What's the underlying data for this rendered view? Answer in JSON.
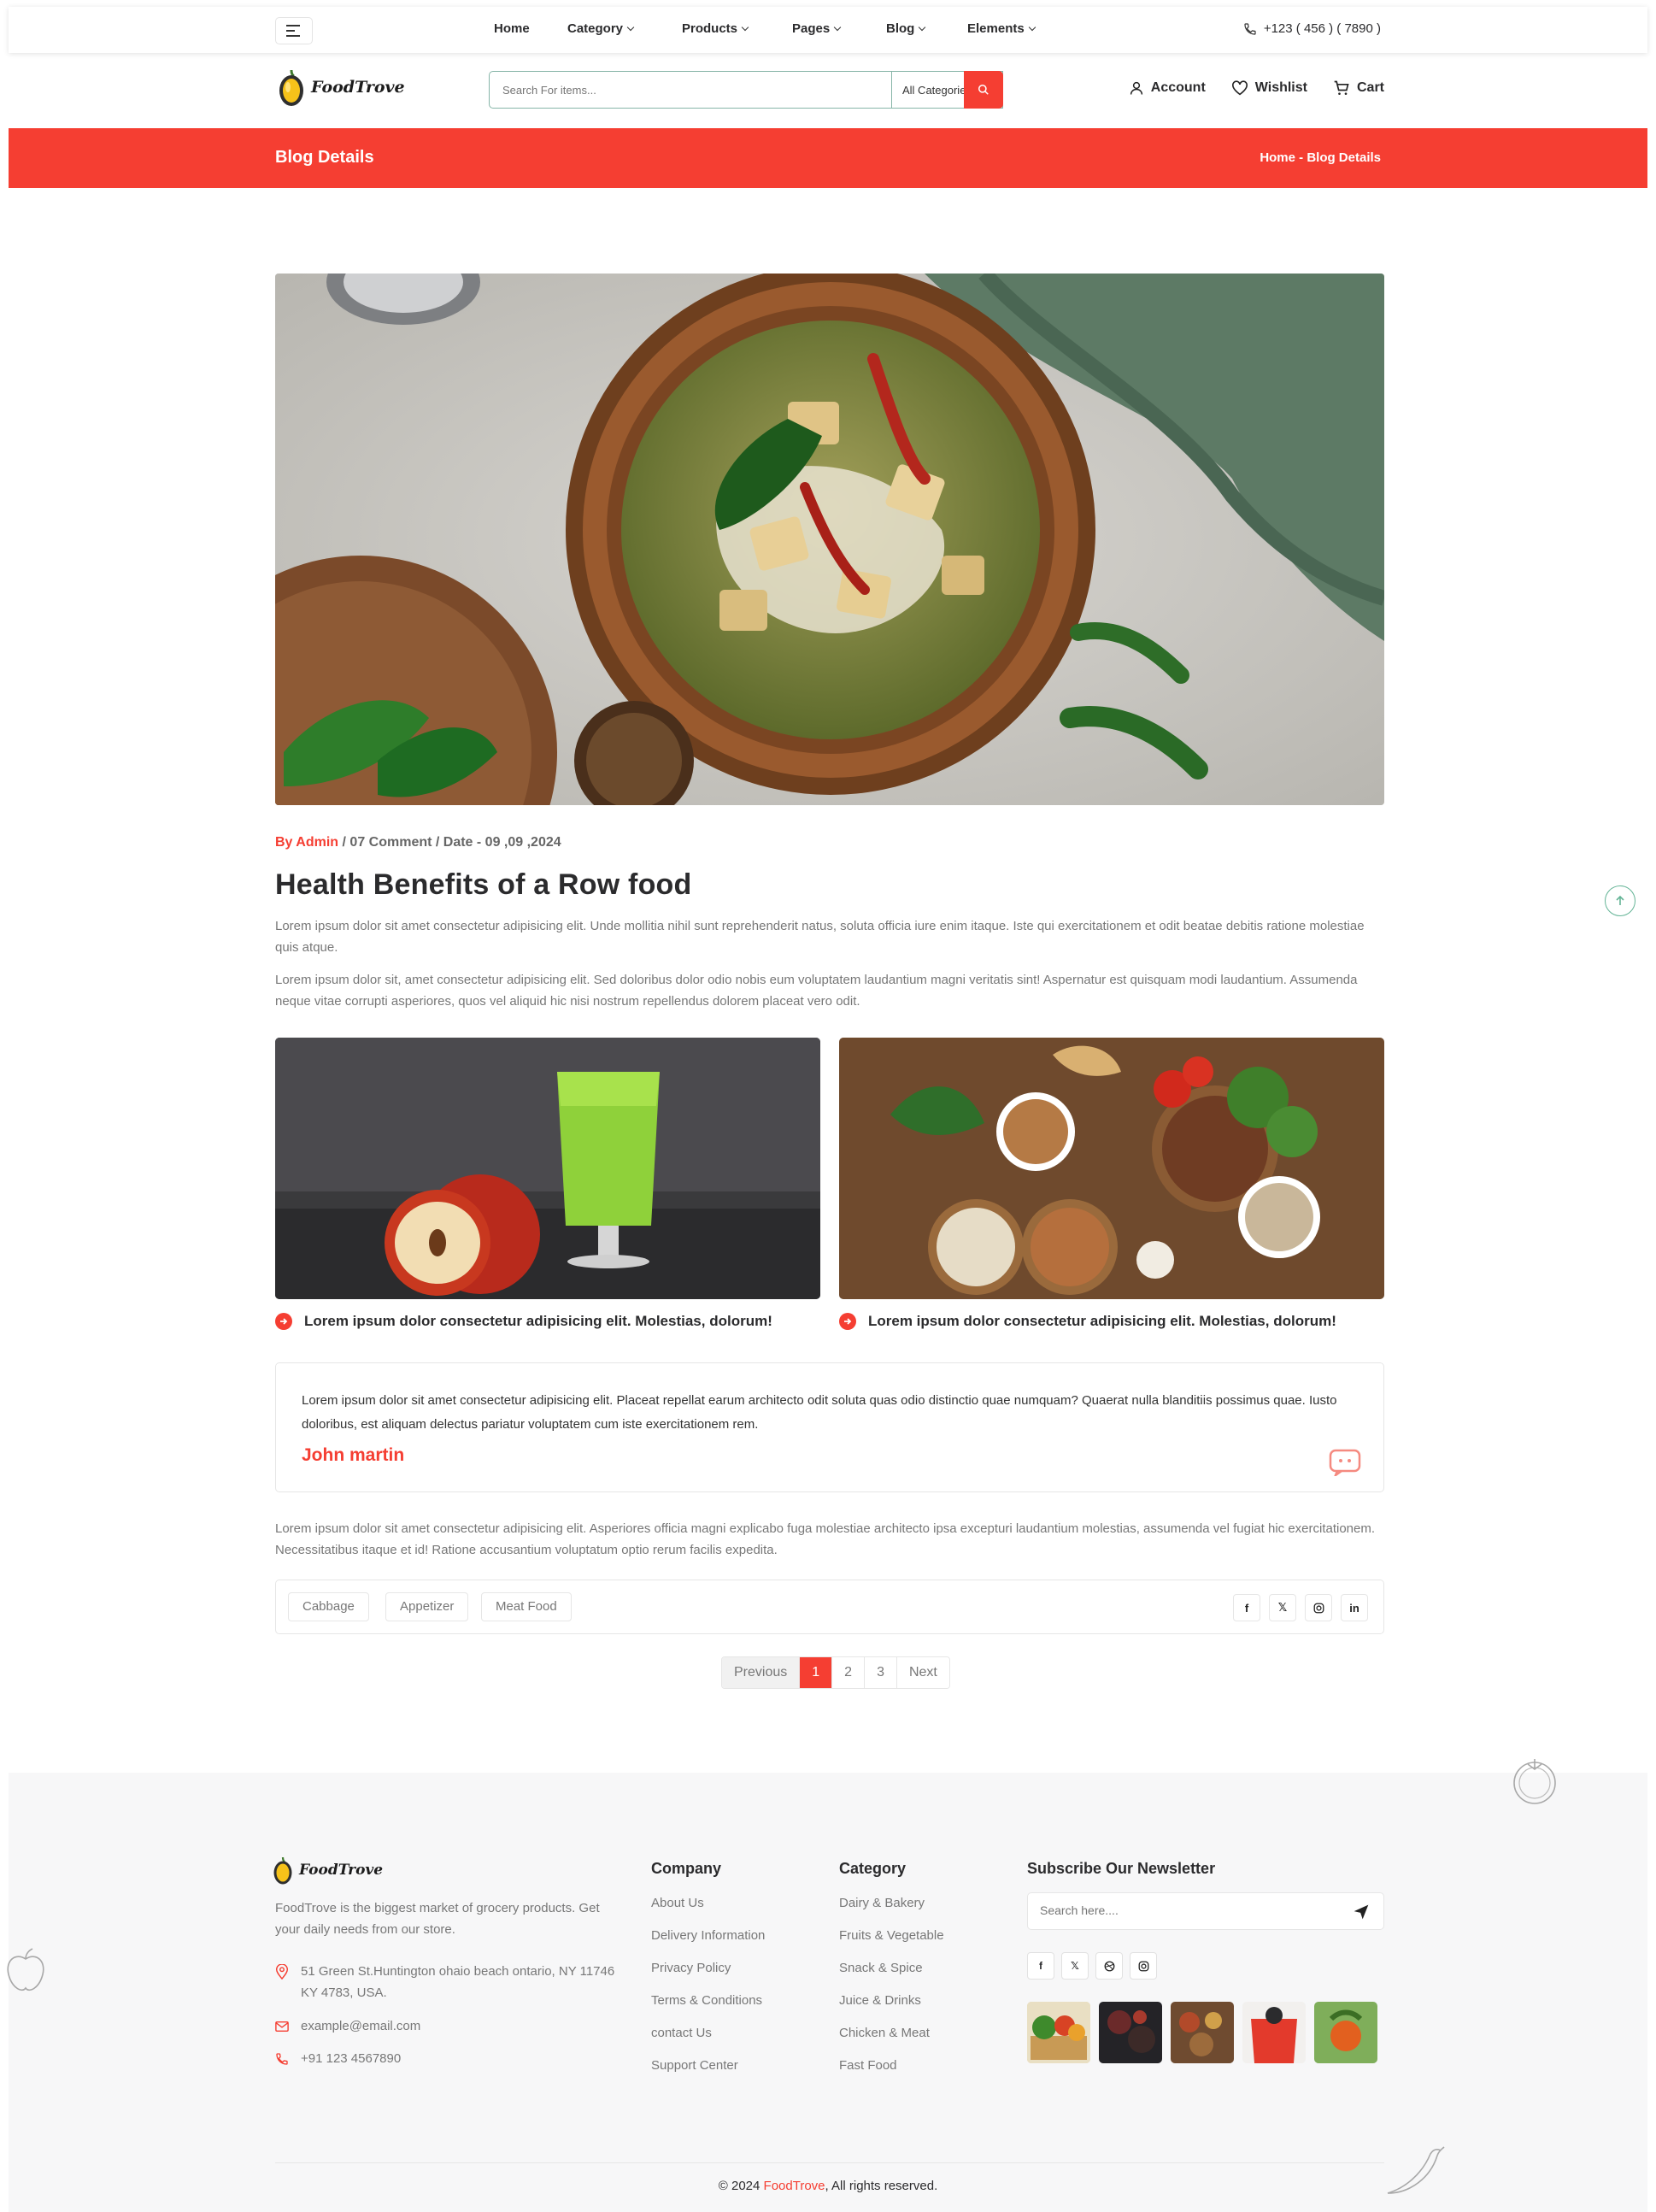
{
  "topbar": {
    "nav": [
      {
        "label": "Home",
        "has_dropdown": false
      },
      {
        "label": "Category",
        "has_dropdown": true
      },
      {
        "label": "Products",
        "has_dropdown": true
      },
      {
        "label": "Pages",
        "has_dropdown": true
      },
      {
        "label": "Blog",
        "has_dropdown": true
      },
      {
        "label": "Elements",
        "has_dropdown": true
      }
    ],
    "phone": "+123 ( 456 ) ( 7890 )"
  },
  "header": {
    "logo_text": "FoodTrove",
    "search_placeholder": "Search For items...",
    "search_category": "All Categories",
    "account": "Account",
    "wishlist": "Wishlist",
    "cart": "Cart"
  },
  "banner": {
    "title": "Blog Details",
    "breadcrumb": "Home - Blog Details"
  },
  "post": {
    "meta_author": "By Admin",
    "meta_rest": " / 07 Comment / Date - 09 ,09 ,2024",
    "title": "Health Benefits of a Row food",
    "para1": "Lorem ipsum dolor sit amet consectetur adipisicing elit. Unde mollitia nihil sunt reprehenderit natus, soluta officia iure enim itaque. Iste qui exercitationem et odit beatae debitis ratione molestiae quis atque.",
    "para2": "Lorem ipsum dolor sit, amet consectetur adipisicing elit. Sed doloribus dolor odio nobis eum voluptatem laudantium magni veritatis sint! Aspernatur est quisquam modi laudantium. Assumenda neque vitae corrupti asperiores, quos vel aliquid hic nisi nostrum repellendus dolorem placeat vero odit.",
    "caption1": "Lorem ipsum dolor consectetur adipisicing elit. Molestias, dolorum!",
    "caption2": "Lorem ipsum dolor consectetur adipisicing elit. Molestias, dolorum!",
    "quote_text": "Lorem ipsum dolor sit amet consectetur adipisicing elit. Placeat repellat earum architecto odit soluta quas odio distinctio quae numquam? Quaerat nulla blanditiis possimus quae. Iusto doloribus, est aliquam delectus pariatur voluptatem cum iste exercitationem rem.",
    "quote_author": "John martin",
    "para3": "Lorem ipsum dolor sit amet consectetur adipisicing elit. Asperiores officia magni explicabo fuga molestiae architecto ipsa excepturi laudantium molestias, assumenda vel fugiat hic exercitationem. Necessitatibus itaque et id! Ratione accusantium voluptatum optio rerum facilis expedita.",
    "tags": [
      "Cabbage",
      "Appetizer",
      "Meat Food"
    ],
    "share_icons": [
      "facebook-icon",
      "x-icon",
      "instagram-icon",
      "linkedin-icon"
    ]
  },
  "pagination": {
    "prev": "Previous",
    "pages": [
      "1",
      "2",
      "3"
    ],
    "active": "1",
    "next": "Next"
  },
  "footer": {
    "logo_text": "FoodTrove",
    "about": "FoodTrove is the biggest market of grocery products. Get your daily needs from our store.",
    "address": "51 Green St.Huntington ohaio beach ontario, NY 11746 KY 4783, USA.",
    "email": "example@email.com",
    "phone": "+91 123 4567890",
    "company_title": "Company",
    "company_links": [
      "About Us",
      "Delivery Information",
      "Privacy Policy",
      "Terms & Conditions",
      "contact Us",
      "Support Center"
    ],
    "category_title": "Category",
    "category_links": [
      "Dairy & Bakery",
      "Fruits & Vegetable",
      "Snack & Spice",
      "Juice & Drinks",
      "Chicken & Meat",
      "Fast Food"
    ],
    "newsletter_title": "Subscribe Our Newsletter",
    "newsletter_placeholder": "Search here....",
    "social_icons": [
      "facebook-icon",
      "x-icon",
      "dribbble-icon",
      "instagram-icon"
    ],
    "copyright_prefix": "© 2024 ",
    "copyright_brand": "FoodTrove",
    "copyright_suffix": ", All rights reserved."
  },
  "colors": {
    "accent": "#f53e32",
    "green": "#64b496",
    "text": "#2b2b2d",
    "muted": "#777777"
  }
}
